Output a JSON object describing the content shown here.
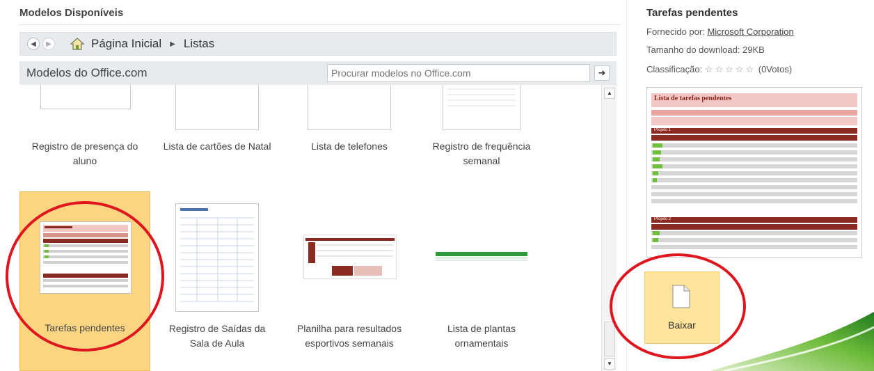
{
  "left": {
    "section_title": "Modelos Disponíveis",
    "breadcrumb": {
      "home": "Página Inicial",
      "current": "Listas"
    },
    "office_bar_label": "Modelos do Office.com",
    "search_placeholder": "Procurar modelos no Office.com",
    "templates": [
      {
        "label_line1": "Registro de presença do",
        "label_line2": "aluno"
      },
      {
        "label_line1": "Lista de cartões de Natal",
        "label_line2": ""
      },
      {
        "label_line1": "Lista de telefones",
        "label_line2": ""
      },
      {
        "label_line1": "Registro de frequência",
        "label_line2": "semanal"
      },
      {
        "label_line1": "Tarefas pendentes",
        "label_line2": "",
        "selected": true
      },
      {
        "label_line1": "Registro de Saídas da",
        "label_line2": "Sala de Aula"
      },
      {
        "label_line1": "Planilha para resultados",
        "label_line2": "esportivos semanais"
      },
      {
        "label_line1": "Lista de plantas",
        "label_line2": "ornamentais"
      }
    ]
  },
  "right": {
    "title": "Tarefas pendentes",
    "provider_label": "Fornecido por:",
    "provider": "Microsoft Corporation",
    "size_text": "Tamanho do download: 29KB",
    "rating_label": "Classificação:",
    "stars": "☆☆☆☆☆",
    "votes": "(0Votos)",
    "preview": {
      "title": "Lista de tarefas pendentes",
      "section1": "Projeto 1",
      "section2": "Projeto 2"
    },
    "download_label": "Baixar"
  },
  "colors": {
    "selection": "#fbd581",
    "download_button": "#fde49a",
    "annotation": "#e0161e",
    "preview_header": "#8b2a20",
    "preview_light": "#f2c6c2"
  }
}
